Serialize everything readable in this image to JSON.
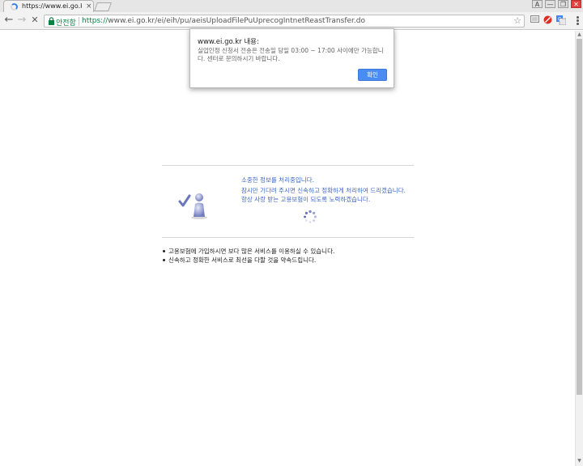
{
  "tab": {
    "title": "https://www.ei.go.kr/e",
    "close": "×"
  },
  "window_controls": {
    "profile": "A",
    "minimize": "—",
    "restore": "❐",
    "close": "✕"
  },
  "toolbar": {
    "back": "←",
    "forward": "→",
    "stop": "✕",
    "secure_label": "안전함",
    "url_scheme": "https://",
    "url_rest": "www.ei.go.kr/ei/eih/pu/aeisUploadFilePuUprecogIntnetReastTransfer.do",
    "star": "☆"
  },
  "extensions": [
    "cast-icon",
    "block-icon",
    "translate-icon"
  ],
  "dialog": {
    "title": "www.ei.go.kr 내용:",
    "message": "실업인정 신청서 전송은 전송일 당일 03:00 ~ 17:00 사이에만 가능합니다. 센터로 문의하시기 바랍니다.",
    "ok_label": "확인"
  },
  "panel": {
    "messages": [
      "소중한 정보를 처리중입니다.",
      "잠시만 기다려 주시면 신속하고 정확하게 처리하여 드리겠습니다.",
      "항상 사랑 받는 고용보험이 되도록 노력하겠습니다."
    ],
    "bullets": [
      "고용보험에 가입하시면 보다 많은 서비스를 이용하실 수 있습니다.",
      "신속하고 정확한 서비스로 최선을 다할 것을 약속드립니다."
    ]
  },
  "colors": {
    "accent": "#4a8df2",
    "secure_green": "#0b8043",
    "message_blue": "#3d67c8"
  }
}
